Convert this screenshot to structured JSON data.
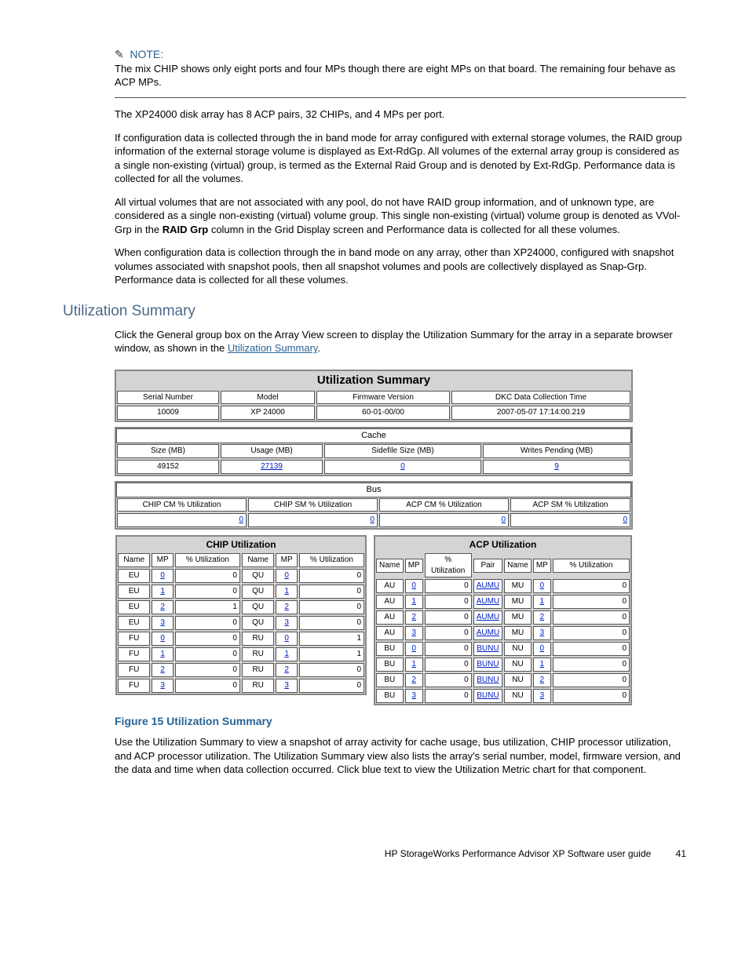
{
  "note": {
    "label": "NOTE:",
    "text": "The mix CHIP shows only eight ports and four MPs though there are eight MPs on that board. The remaining four behave as ACP MPs."
  },
  "para1": "The XP24000 disk array has 8 ACP pairs, 32 CHIPs, and 4 MPs per port.",
  "para2": "If configuration data is collected through the in band mode for array configured with external storage volumes, the RAID group information of the external storage volume is displayed as Ext-RdGp. All volumes of the external array group is considered as a single non-existing (virtual) group, is termed as the External Raid Group and is denoted by Ext-RdGp. Performance data is collected for all the volumes.",
  "para3_a": "All virtual volumes that are not associated with any pool, do not have RAID group information, and of unknown type, are considered as a single non-existing (virtual) volume group. This single non-existing (virtual) volume group is denoted as VVol-Grp in the ",
  "para3_bold": "RAID Grp",
  "para3_b": " column in the Grid Display screen and Performance data is collected for all these volumes.",
  "para4": "When configuration data is collection through the in band mode on any array, other than XP24000, configured with snapshot volumes associated with snapshot pools, then all snapshot volumes and pools are collectively displayed as Snap-Grp. Performance data is collected for all these volumes.",
  "heading": "Utilization Summary",
  "para5_a": "Click the General group box on the Array View screen to display the Utilization Summary for the array in a separate browser window, as shown in the ",
  "para5_link": "Utilization Summary",
  "para5_b": ".",
  "fig": {
    "title": "Utilization Summary",
    "top_hdr": [
      "Serial Number",
      "Model",
      "Firmware Version",
      "DKC Data Collection Time"
    ],
    "top_val": [
      "10009",
      "XP 24000",
      "60-01-00/00",
      "2007-05-07 17:14:00.219"
    ],
    "cache_title": "Cache",
    "cache_hdr": [
      "Size (MB)",
      "Usage (MB)",
      "Sidefile Size (MB)",
      "Writes Pending (MB)"
    ],
    "cache_val": [
      "49152",
      "27139",
      "0",
      "9"
    ],
    "bus_title": "Bus",
    "bus_hdr": [
      "CHIP CM % Utilization",
      "CHIP SM % Utilization",
      "ACP CM % Utilization",
      "ACP SM % Utilization"
    ],
    "bus_val": [
      "0",
      "0",
      "0",
      "0"
    ],
    "chip_title": "CHIP Utilization",
    "acp_title": "ACP Utilization",
    "col_hdr": {
      "name": "Name",
      "mp": "MP",
      "util": "% Utilization",
      "pair": "Pair"
    },
    "chip_left": [
      {
        "n": "EU",
        "mp": "0",
        "u": "0"
      },
      {
        "n": "EU",
        "mp": "1",
        "u": "0"
      },
      {
        "n": "EU",
        "mp": "2",
        "u": "1"
      },
      {
        "n": "EU",
        "mp": "3",
        "u": "0"
      },
      {
        "n": "FU",
        "mp": "0",
        "u": "0"
      },
      {
        "n": "FU",
        "mp": "1",
        "u": "0"
      },
      {
        "n": "FU",
        "mp": "2",
        "u": "0"
      },
      {
        "n": "FU",
        "mp": "3",
        "u": "0"
      }
    ],
    "chip_right": [
      {
        "n": "QU",
        "mp": "0",
        "u": "0"
      },
      {
        "n": "QU",
        "mp": "1",
        "u": "0"
      },
      {
        "n": "QU",
        "mp": "2",
        "u": "0"
      },
      {
        "n": "QU",
        "mp": "3",
        "u": "0"
      },
      {
        "n": "RU",
        "mp": "0",
        "u": "1"
      },
      {
        "n": "RU",
        "mp": "1",
        "u": "1"
      },
      {
        "n": "RU",
        "mp": "2",
        "u": "0"
      },
      {
        "n": "RU",
        "mp": "3",
        "u": "0"
      }
    ],
    "acp_left": [
      {
        "n": "AU",
        "mp": "0",
        "u": "0",
        "p": "AUMU"
      },
      {
        "n": "AU",
        "mp": "1",
        "u": "0",
        "p": "AUMU"
      },
      {
        "n": "AU",
        "mp": "2",
        "u": "0",
        "p": "AUMU"
      },
      {
        "n": "AU",
        "mp": "3",
        "u": "0",
        "p": "AUMU"
      },
      {
        "n": "BU",
        "mp": "0",
        "u": "0",
        "p": "BUNU"
      },
      {
        "n": "BU",
        "mp": "1",
        "u": "0",
        "p": "BUNU"
      },
      {
        "n": "BU",
        "mp": "2",
        "u": "0",
        "p": "BUNU"
      },
      {
        "n": "BU",
        "mp": "3",
        "u": "0",
        "p": "BUNU"
      }
    ],
    "acp_right": [
      {
        "n": "MU",
        "mp": "0",
        "u": "0"
      },
      {
        "n": "MU",
        "mp": "1",
        "u": "0"
      },
      {
        "n": "MU",
        "mp": "2",
        "u": "0"
      },
      {
        "n": "MU",
        "mp": "3",
        "u": "0"
      },
      {
        "n": "NU",
        "mp": "0",
        "u": "0"
      },
      {
        "n": "NU",
        "mp": "1",
        "u": "0"
      },
      {
        "n": "NU",
        "mp": "2",
        "u": "0"
      },
      {
        "n": "NU",
        "mp": "3",
        "u": "0"
      }
    ]
  },
  "fig_caption": "Figure 15 Utilization Summary",
  "para6": "Use the Utilization Summary to view a snapshot of array activity for cache usage, bus utilization, CHIP processor utilization, and ACP processor utilization. The Utilization Summary view also lists the array's serial number, model, firmware version, and the data and time when data collection occurred. Click blue text to view the Utilization Metric chart for that component.",
  "footer": {
    "text": "HP StorageWorks Performance Advisor XP Software user guide",
    "page": "41"
  }
}
